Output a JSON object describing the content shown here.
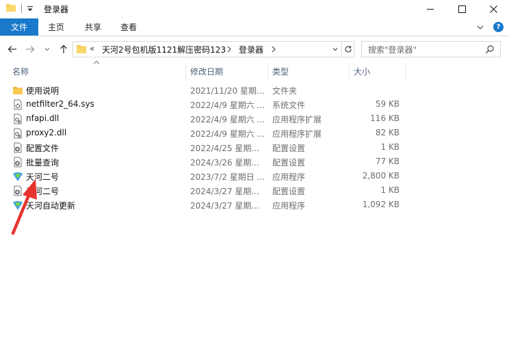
{
  "window": {
    "title": "登录器",
    "controls": {
      "minimize": "minimize-icon",
      "maximize": "maximize-icon",
      "close": "close-icon"
    }
  },
  "ribbon": {
    "tabs": [
      "文件",
      "主页",
      "共享",
      "查看"
    ],
    "help_label": "?"
  },
  "address": {
    "overflow": "«",
    "segments": [
      "天河2号包机版1121解压密码123",
      "登录器"
    ]
  },
  "search": {
    "placeholder": "搜索\"登录器\""
  },
  "columns": {
    "name": "名称",
    "date": "修改日期",
    "type": "类型",
    "size": "大小"
  },
  "files": [
    {
      "name": "使用说明",
      "date": "2021/11/20 星期...",
      "type": "文件夹",
      "size": "",
      "icon": "folder-icon"
    },
    {
      "name": "netfilter2_64.sys",
      "date": "2022/4/9 星期六 ...",
      "type": "系统文件",
      "size": "59 KB",
      "icon": "system-file-icon"
    },
    {
      "name": "nfapi.dll",
      "date": "2022/4/9 星期六 ...",
      "type": "应用程序扩展",
      "size": "116 KB",
      "icon": "dll-file-icon"
    },
    {
      "name": "proxy2.dll",
      "date": "2022/4/9 星期六 ...",
      "type": "应用程序扩展",
      "size": "82 KB",
      "icon": "dll-file-icon"
    },
    {
      "name": "配置文件",
      "date": "2022/4/25 星期...",
      "type": "配置设置",
      "size": "1 KB",
      "icon": "config-file-icon"
    },
    {
      "name": "批量查询",
      "date": "2024/3/26 星期...",
      "type": "配置设置",
      "size": "77 KB",
      "icon": "config-file-icon"
    },
    {
      "name": "天河二号",
      "date": "2023/7/2 星期日 ...",
      "type": "应用程序",
      "size": "2,800 KB",
      "icon": "app-icon"
    },
    {
      "name": "天河二号",
      "date": "2024/3/27 星期...",
      "type": "配置设置",
      "size": "1 KB",
      "icon": "config-file-icon"
    },
    {
      "name": "天河自动更新",
      "date": "2024/3/27 星期...",
      "type": "应用程序",
      "size": "1,092 KB",
      "icon": "app-icon"
    }
  ],
  "colors": {
    "file_tab": "#1979ca",
    "header_text": "#4c607a",
    "annotation": "#e8322e",
    "folder": "#f7c950"
  }
}
